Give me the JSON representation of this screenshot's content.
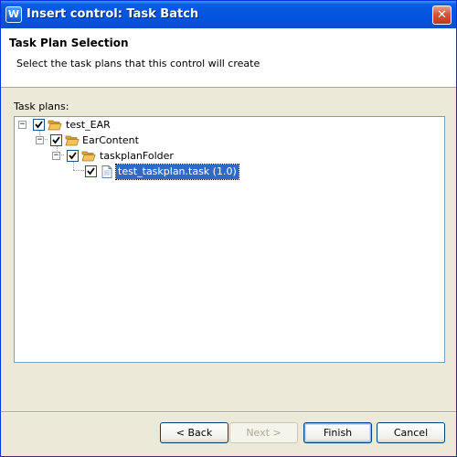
{
  "window": {
    "title": "Insert control: Task Batch",
    "app_icon_glyph": "W",
    "close_glyph": "✕"
  },
  "header": {
    "title": "Task Plan Selection",
    "description": "Select the task plans that this control will create"
  },
  "tree": {
    "label": "Task plans:",
    "nodes": [
      {
        "label": "test_EAR",
        "checked": true,
        "expander": "−",
        "icon": "open-folder-icon"
      },
      {
        "label": "EarContent",
        "checked": true,
        "expander": "−",
        "icon": "open-folder-icon"
      },
      {
        "label": "taskplanFolder",
        "checked": true,
        "expander": "−",
        "icon": "open-folder-icon"
      },
      {
        "label": "test_taskplan.task (1.0)",
        "checked": true,
        "icon": "file-icon",
        "selected": true
      }
    ]
  },
  "buttons": {
    "back": "< Back",
    "next": "Next >",
    "finish": "Finish",
    "cancel": "Cancel"
  },
  "colors": {
    "selection": "#316ac5",
    "titlebar": "#0455e0",
    "folder": "#f5c15a"
  }
}
